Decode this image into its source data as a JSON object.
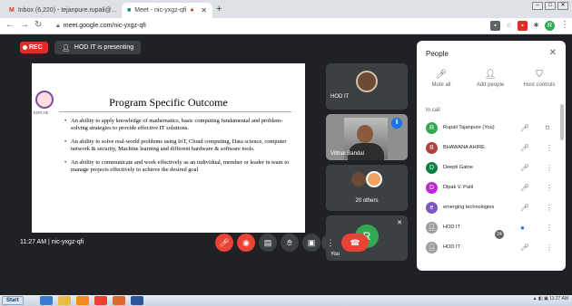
{
  "browser": {
    "tabs": [
      {
        "title": "Inbox (6,220) - tejanpure.rupali@...",
        "icon": "gmail-icon"
      },
      {
        "title": "Meet - nic-yxgz-qfi",
        "icon": "meet-icon"
      }
    ],
    "new_tab": "+",
    "url": "meet.google.com/nic-yxgz-qfi"
  },
  "meet": {
    "rec_label": "REC",
    "presenting_label": "HOD IT is presenting",
    "slide": {
      "logo_text": "KDTCOE",
      "title": "Program Specific Outcome",
      "bullets": [
        "An ability to apply knowledge of mathematics, basic computing fundamental and problem-solving strategies to provide effective IT solutions.",
        "An ability to solve real-world problems using IoT, Cloud computing, Data science, computer network & security, Machine learning and different hardware & software tools.",
        "An ability to communicate and work effectively as an individual, member or leader in team to manage projects effectively to achieve the desired goal"
      ]
    },
    "tiles": [
      {
        "name": "HOD IT"
      },
      {
        "name": "Vitthal Bandal"
      },
      {
        "name": "20 others"
      },
      {
        "name": "You",
        "initial": "R"
      }
    ],
    "clock": "11:27 AM",
    "meeting_code": "nic-yxgz-qfi",
    "participant_count_badge": "24"
  },
  "people_panel": {
    "title": "People",
    "actions": [
      {
        "label": "Mute all",
        "icon": "mic-off-icon"
      },
      {
        "label": "Add people",
        "icon": "add-person-icon"
      },
      {
        "label": "Host controls",
        "icon": "shield-icon"
      }
    ],
    "section_label": "In call",
    "participants": [
      {
        "name": "Rupali Tajanpure (You)",
        "initial": "R",
        "color": "#34a853"
      },
      {
        "name": "BHAWANA AHIRE",
        "initial": "B",
        "color": "#b0413e"
      },
      {
        "name": "Deepti Gatne",
        "initial": "D",
        "color": "#0b8043"
      },
      {
        "name": "Dipak V. Patil",
        "initial": "D",
        "color": "#c026d3"
      },
      {
        "name": "emerging technologies",
        "initial": "e",
        "color": "#7e57c2"
      },
      {
        "name": "HOD IT",
        "initial": "",
        "color": "#9e9e9e"
      },
      {
        "name": "HOD IT",
        "initial": "",
        "color": "#9e9e9e"
      }
    ]
  },
  "taskbar": {
    "start_label": "Start"
  }
}
